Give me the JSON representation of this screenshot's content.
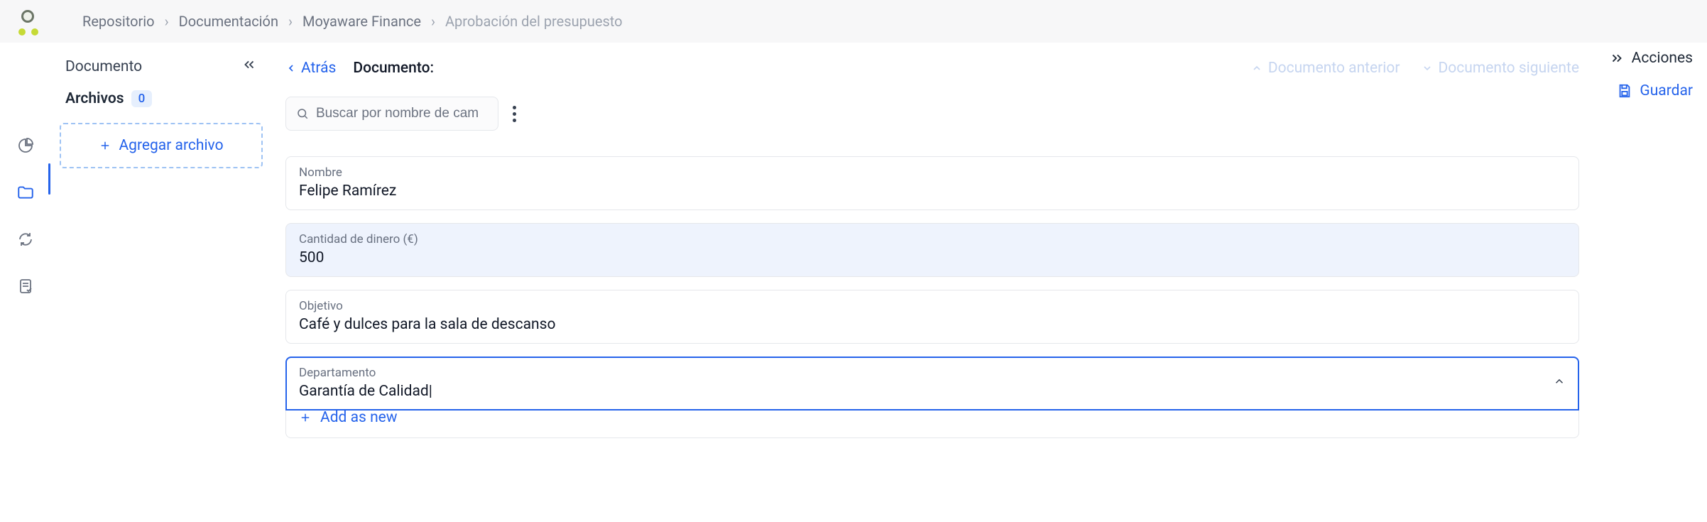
{
  "breadcrumb": {
    "items": [
      "Repositorio",
      "Documentación",
      "Moyaware Finance"
    ],
    "current": "Aprobación del presupuesto"
  },
  "sidebar": {
    "title": "Documento",
    "files_label": "Archivos",
    "file_count": "0",
    "add_file_label": "Agregar archivo"
  },
  "main": {
    "back_label": "Atrás",
    "doc_label": "Documento:",
    "prev_doc": "Documento anterior",
    "next_doc": "Documento siguiente",
    "search_placeholder": "Buscar por nombre de cam",
    "fields": {
      "name": {
        "label": "Nombre",
        "value": "Felipe Ramírez"
      },
      "amount": {
        "label": "Cantidad de dinero (€)",
        "value": "500"
      },
      "goal": {
        "label": "Objetivo",
        "value": "Café y dulces para la sala de descanso"
      },
      "dept": {
        "label": "Departamento",
        "value": "Garantía de Calidad"
      }
    },
    "add_as_new": "Add as new"
  },
  "actions": {
    "label": "Acciones",
    "save": "Guardar"
  }
}
